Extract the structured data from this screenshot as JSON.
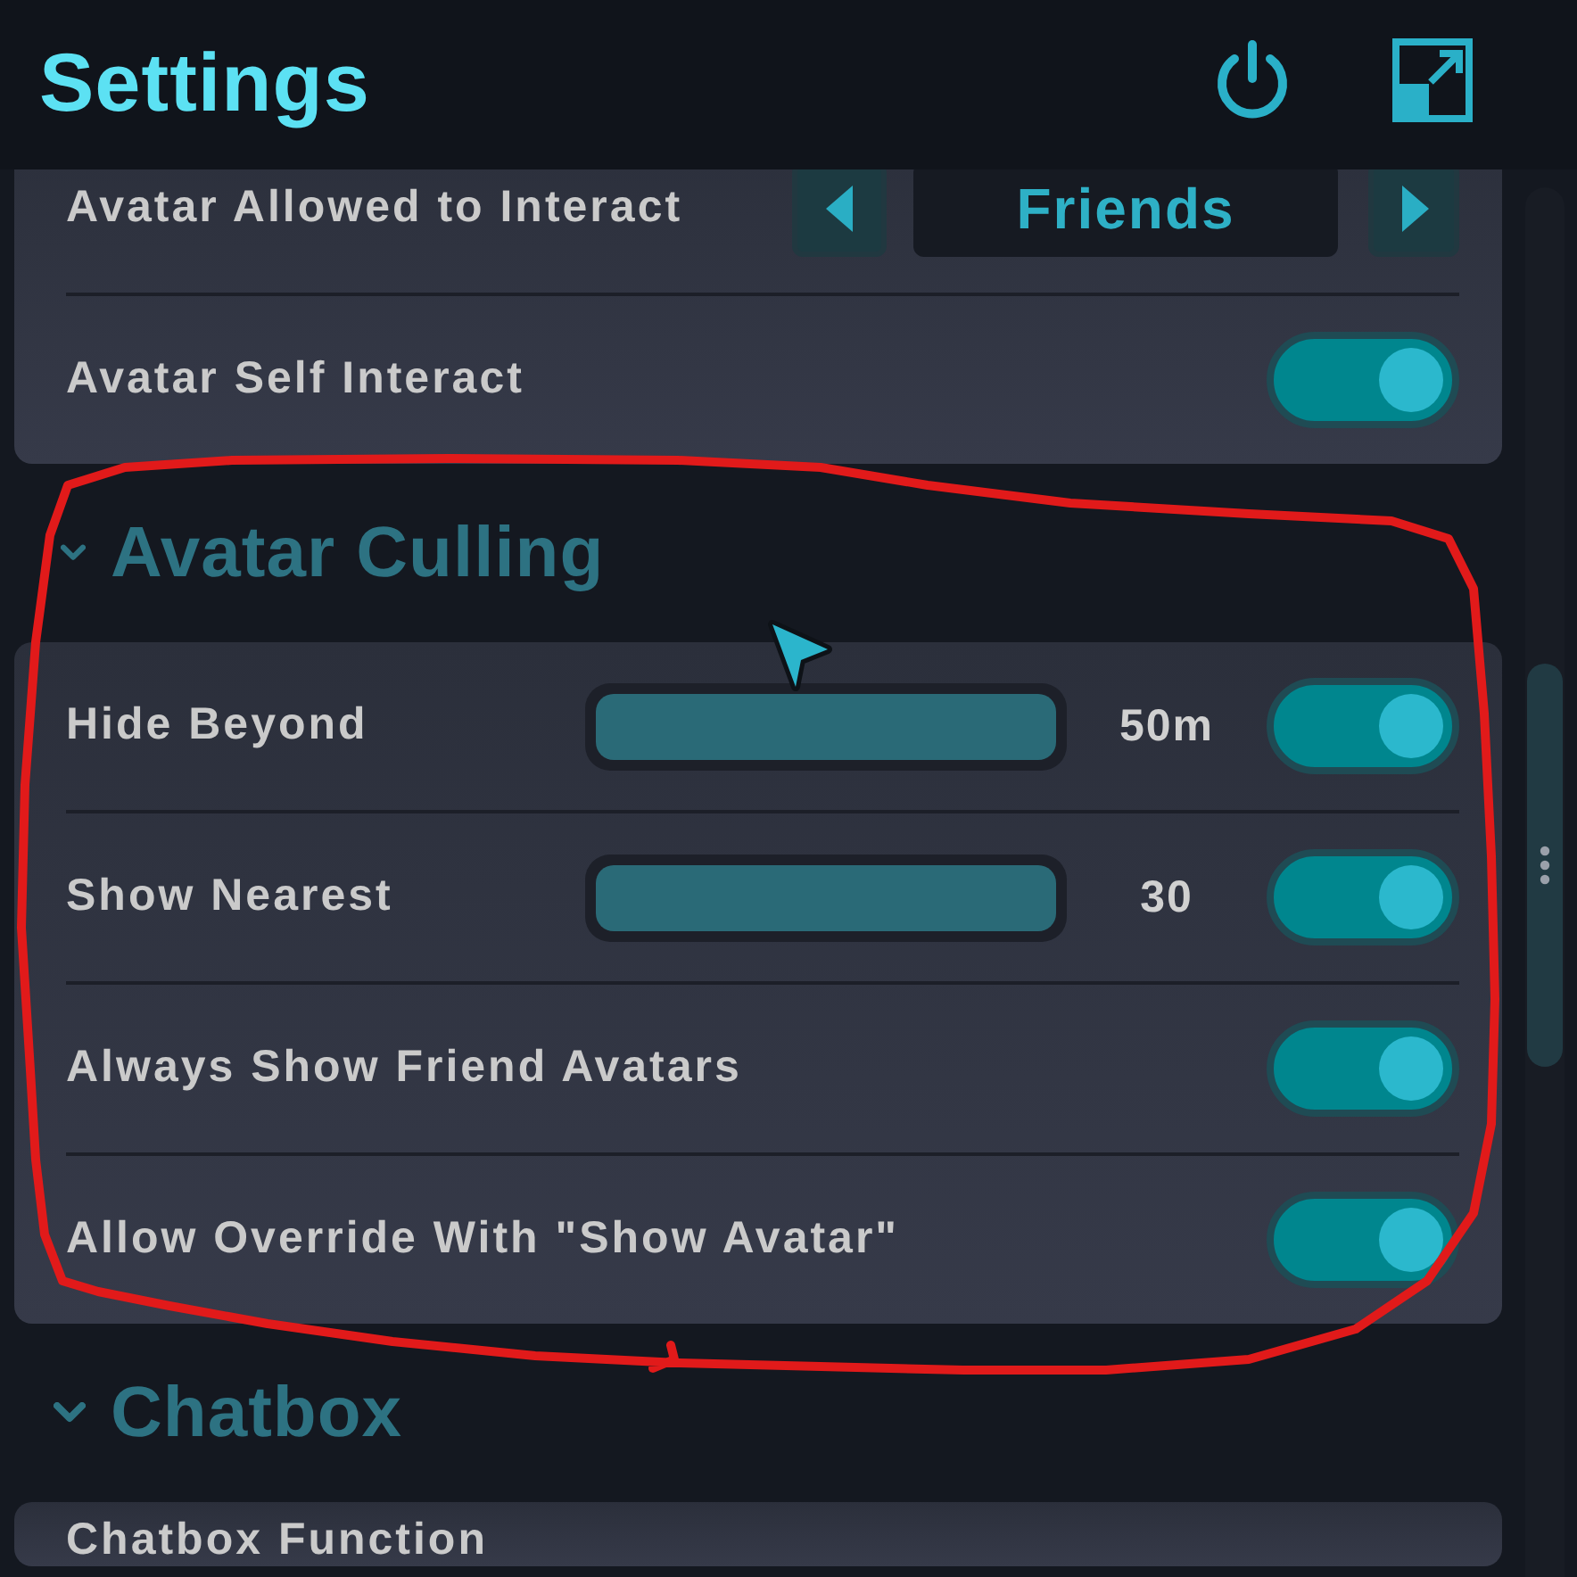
{
  "header": {
    "title": "Settings"
  },
  "sections": [
    {
      "rows": [
        {
          "kind": "selector",
          "label": "Avatar Allowed to Interact",
          "value": "Friends"
        },
        {
          "kind": "toggle",
          "label": "Avatar Self Interact",
          "on": true
        }
      ]
    },
    {
      "title": "Avatar Culling",
      "expanded": true,
      "rows": [
        {
          "kind": "slider",
          "label": "Hide Beyond",
          "level": 1,
          "reading": "50m",
          "on": true
        },
        {
          "kind": "slider",
          "label": "Show Nearest",
          "level": 1,
          "reading": "30",
          "on": true
        },
        {
          "kind": "toggle",
          "label": "Always Show Friend Avatars",
          "on": true
        },
        {
          "kind": "toggle",
          "label": "Allow Override With \"Show Avatar\"",
          "on": true
        }
      ]
    },
    {
      "title": "Chatbox",
      "expanded": true,
      "rows": [
        {
          "kind": "text",
          "label": "Chatbox Function"
        }
      ]
    }
  ]
}
